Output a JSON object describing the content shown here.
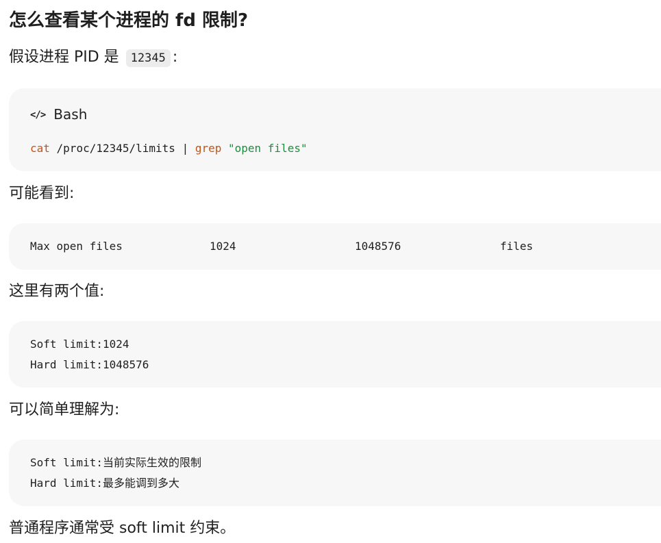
{
  "heading": "怎么查看某个进程的 fd 限制?",
  "intro": {
    "text_before": "假设进程 PID 是",
    "pid_code": "12345",
    "text_after": ":"
  },
  "bash_block": {
    "lang_icon": "code-icon",
    "lang_label": "Bash",
    "cmd": "cat",
    "arg": " /proc/12345/limits | ",
    "pipe_cmd": "grep",
    "pattern": "\"open files\""
  },
  "p_see": "可能看到:",
  "limits_row": {
    "name": "Max open files",
    "soft": "1024",
    "hard": "1048576",
    "units": "files"
  },
  "p_two_values": "这里有两个值:",
  "values_block": {
    "soft_line": "Soft limit:1024",
    "hard_line": "Hard limit:1048576"
  },
  "p_understand": "可以简单理解为:",
  "meaning_block": {
    "soft_key": "Soft limit:",
    "soft_desc": "当前实际生效的限制",
    "hard_key": "Hard limit:",
    "hard_desc": "最多能调到多大"
  },
  "p_final": "普通程序通常受 soft limit 约束。"
}
